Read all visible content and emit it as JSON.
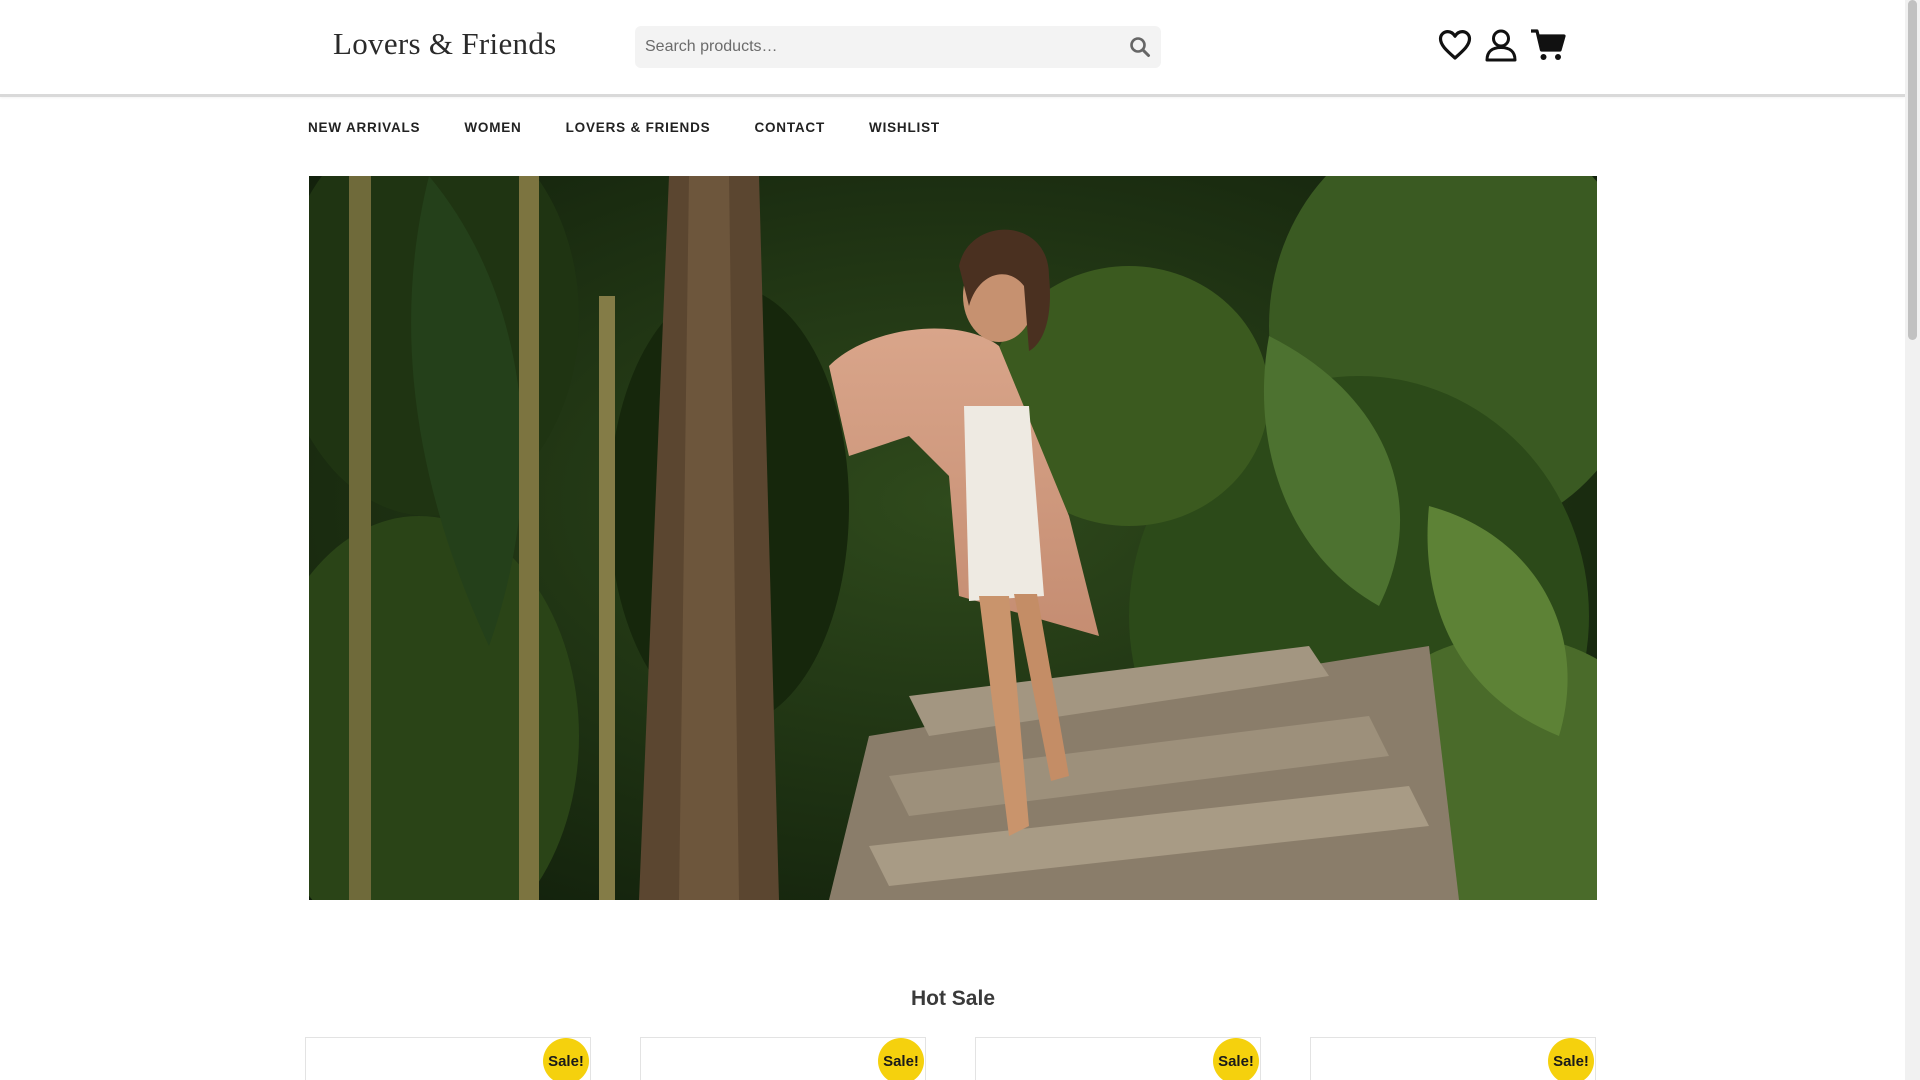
{
  "header": {
    "logo_text": "Lovers & Friends",
    "search": {
      "placeholder": "Search products…",
      "value": ""
    }
  },
  "nav": {
    "items": [
      "NEW ARRIVALS",
      "WOMEN",
      "LOVERS & FRIENDS",
      "CONTACT",
      "WISHLIST"
    ]
  },
  "icons": {
    "search": "search-icon",
    "wishlist": "heart-icon",
    "account": "user-icon",
    "cart": "cart-icon"
  },
  "hot_sale": {
    "title": "Hot Sale",
    "products": [
      {
        "badge": "Sale!"
      },
      {
        "badge": "Sale!"
      },
      {
        "badge": "Sale!"
      },
      {
        "badge": "Sale!"
      }
    ]
  },
  "colors": {
    "badge": "#f5d10d",
    "search_bg": "#f3f3f3",
    "header_border": "#d9d9d9"
  }
}
